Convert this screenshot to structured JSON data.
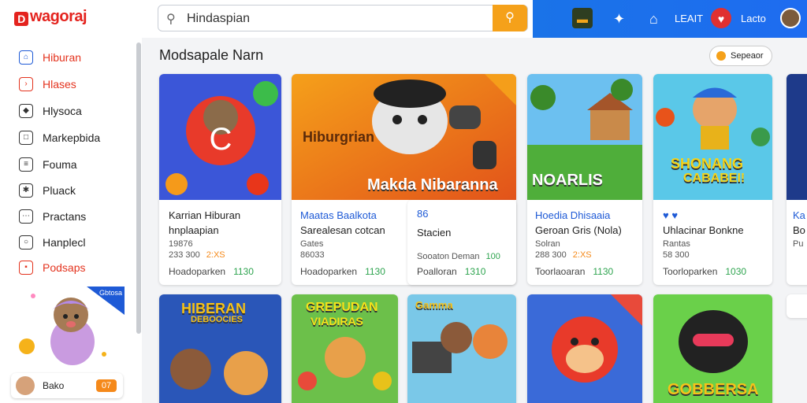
{
  "header": {
    "logo": "wagoraj",
    "logo_mark": "D",
    "search_value": "Hindaspian",
    "nav_label_1": "LEAIT",
    "nav_label_2": "Lacto"
  },
  "sidebar": {
    "items": [
      {
        "label": "Hiburan",
        "icon": "home-icon"
      },
      {
        "label": "Hlases",
        "icon": "cart-icon"
      },
      {
        "label": "Hlysoca",
        "icon": "tag-icon"
      },
      {
        "label": "Markepbida",
        "icon": "store-icon"
      },
      {
        "label": "Fouma",
        "icon": "chat-icon"
      },
      {
        "label": "Pluack",
        "icon": "puzzle-icon"
      },
      {
        "label": "Practans",
        "icon": "gift-icon"
      },
      {
        "label": "Hanplecl",
        "icon": "bag-icon"
      },
      {
        "label": "Podsaps",
        "icon": "card-icon"
      }
    ],
    "promo_badge": "Gbtosa",
    "user_name": "Bako",
    "user_badge": "07"
  },
  "main": {
    "title": "Modsapale Narn",
    "sort_label": "Sepeaor"
  },
  "cards_row1": [
    {
      "title": "Karrian Hiburan",
      "subtitle": "hnplaapian",
      "meta": "19876",
      "price": "233 300",
      "highlight": "2:XS",
      "seller": "Hoadoparken",
      "count": "1130"
    },
    {
      "title": "Maatas Baalkota",
      "subtitle": "Sarealesan cotcan",
      "meta": "Gates",
      "price": "86033",
      "highlight": "",
      "seller": "Hoadoparken",
      "count": "1130",
      "thumb_text_a": "Hiburgrian",
      "thumb_text_b": "Makda Nibaranna"
    },
    {
      "title": "86",
      "subtitle": "Stacien",
      "meta": "",
      "price": "Sooaton Deman",
      "highlight": "100",
      "seller": "Poalloran",
      "count": "1310"
    },
    {
      "title": "Hoedia Dhisaaia",
      "subtitle": "Geroan Gris (Nola)",
      "meta": "Solran",
      "price": "288 300",
      "highlight": "2:XS",
      "seller": "Toorlaoaran",
      "count": "1130",
      "thumb_text_a": "NOARLIS"
    },
    {
      "title": "",
      "subtitle": "Uhlacinar Bonkne",
      "meta": "Rantas",
      "price": "58 300",
      "highlight": "",
      "seller": "Toorloparken",
      "count": "1030",
      "thumb_text_a": "SHONANG",
      "thumb_text_b": "CABABEI!"
    }
  ],
  "cards_row2": [
    {
      "thumb_text_a": "HIBERAN",
      "thumb_text_b": "DEBOOCIES"
    },
    {
      "thumb_text_a": "GREPUDAN",
      "thumb_text_b": "VIADIRAS"
    },
    {
      "thumb_text_a": "Gamma"
    },
    {
      "thumb_text_a": ""
    },
    {
      "thumb_text_a": "GOBBERSA"
    }
  ],
  "partial_card": {
    "title": "Ka",
    "lines": [
      "Bo",
      "Pu"
    ]
  },
  "colors": {
    "brand": "#e4231e",
    "accent": "#f5a11a",
    "header_blue": "#1a73e8",
    "link_blue": "#1e5ad6"
  }
}
